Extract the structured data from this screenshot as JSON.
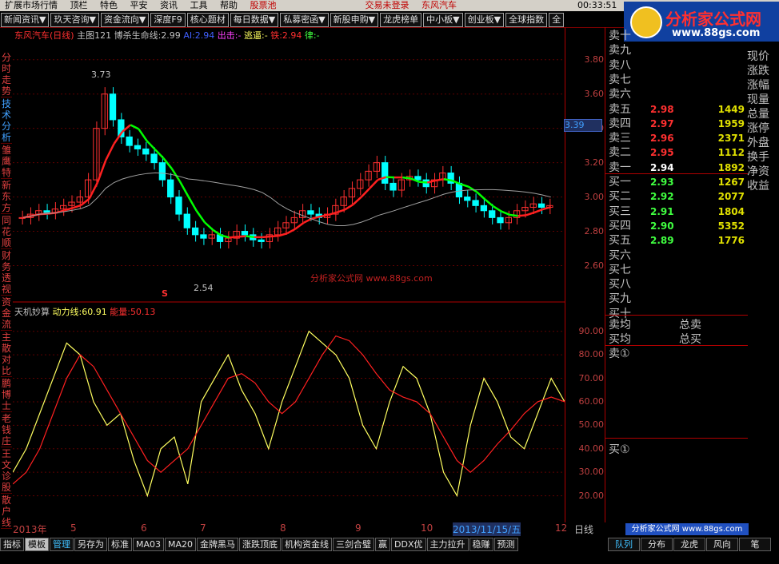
{
  "topbar": {
    "items": [
      "扩展市场行情",
      "顶栏",
      "特色",
      "平安",
      "资讯",
      "工具",
      "帮助"
    ],
    "pool": "股票池",
    "login": "交易未登录",
    "stock": "东风汽车",
    "clock": "00:33:51"
  },
  "menu": [
    "新闻资讯▼",
    "玖天咨询▼",
    "资金流向▼",
    "深度F9",
    "核心题材",
    "每日数据▼",
    "私募密函▼",
    "新股申购▼",
    "龙虎榜单",
    "中小板▼",
    "创业板▼",
    "全球指数",
    "全"
  ],
  "logo": {
    "title": "分析家公式网",
    "url": "www.88gs.com"
  },
  "sidebar": [
    {
      "label": "分时走势",
      "color": "red"
    },
    {
      "label": "技术分析",
      "color": "blue"
    },
    {
      "label": "雏鹰特",
      "color": "red"
    },
    {
      "label": "新东方",
      "color": "red"
    },
    {
      "label": "同花顺",
      "color": "red"
    },
    {
      "label": "财务透视",
      "color": "red"
    },
    {
      "label": "资金流",
      "color": "red"
    },
    {
      "label": "主散对比",
      "color": "red"
    },
    {
      "label": "鹏博士",
      "color": "red"
    },
    {
      "label": "老钱庄",
      "color": "red"
    },
    {
      "label": "王文诊股",
      "color": "red"
    },
    {
      "label": "散户线",
      "color": "red"
    }
  ],
  "main_header": {
    "name": "东风汽车(日线)",
    "chart": "主图121",
    "line1_label": "博杀生命线:",
    "line1_val": "2.99",
    "ai_label": "AI:",
    "ai_val": "2.94",
    "out_label": "出击:",
    "out_val": "-",
    "escape_label": "逃逼:",
    "escape_val": "-",
    "iron_label": "铁:",
    "iron_val": "2.94",
    "law_label": "律:",
    "law_val": "-"
  },
  "sub_header": {
    "name": "天机妙算",
    "power_label": "动力线:",
    "power_val": "60.91",
    "energy_label": "能量:",
    "energy_val": "50.13"
  },
  "annotations": {
    "high": "3.73",
    "low": "2.54",
    "watermark": "分析家公式网 www.88gs.com",
    "s_mark": "S"
  },
  "main_y": [
    "3.80",
    "3.60",
    "3.40",
    "3.20",
    "3.00",
    "2.80",
    "2.60"
  ],
  "sub_y": [
    "90.00",
    "80.00",
    "70.00",
    "60.00",
    "50.00",
    "40.00",
    "30.00",
    "20.00"
  ],
  "price_marker": "3.39",
  "x_axis": [
    "2013年",
    "5",
    "6",
    "7",
    "8",
    "9",
    "10",
    "2013/11/15/五",
    "12"
  ],
  "period": "日线",
  "order_book": {
    "sell": [
      {
        "label": "卖十",
        "price": "",
        "vol": ""
      },
      {
        "label": "卖九",
        "price": "",
        "vol": ""
      },
      {
        "label": "卖八",
        "price": "",
        "vol": ""
      },
      {
        "label": "卖七",
        "price": "",
        "vol": ""
      },
      {
        "label": "卖六",
        "price": "",
        "vol": ""
      },
      {
        "label": "卖五",
        "price": "2.98",
        "vol": "1449"
      },
      {
        "label": "卖四",
        "price": "2.97",
        "vol": "1959"
      },
      {
        "label": "卖三",
        "price": "2.96",
        "vol": "2371"
      },
      {
        "label": "卖二",
        "price": "2.95",
        "vol": "1112"
      },
      {
        "label": "卖一",
        "price": "2.94",
        "vol": "1892"
      }
    ],
    "buy": [
      {
        "label": "买一",
        "price": "2.93",
        "vol": "1267"
      },
      {
        "label": "买二",
        "price": "2.92",
        "vol": "2077"
      },
      {
        "label": "买三",
        "price": "2.91",
        "vol": "1804"
      },
      {
        "label": "买四",
        "price": "2.90",
        "vol": "5352"
      },
      {
        "label": "买五",
        "price": "2.89",
        "vol": "1776"
      },
      {
        "label": "买六",
        "price": "",
        "vol": ""
      },
      {
        "label": "买七",
        "price": "",
        "vol": ""
      },
      {
        "label": "买八",
        "price": "",
        "vol": ""
      },
      {
        "label": "买九",
        "price": "",
        "vol": ""
      },
      {
        "label": "买十",
        "price": "",
        "vol": ""
      }
    ],
    "sell_avg": "卖均",
    "buy_avg": "买均",
    "total_sell": "总卖",
    "total_buy": "总买",
    "sell_queue": "卖①",
    "buy_queue": "买①"
  },
  "right_fields": [
    "现价",
    "涨跌",
    "涨幅",
    "现量",
    "总量",
    "涨停",
    "外盘",
    "",
    "换手",
    "净资",
    "收益"
  ],
  "bottom_tabs": [
    "指标",
    "模板",
    "管理",
    "另存为",
    "标准",
    "MA03",
    "MA20",
    "金牌黑马",
    "涨跌顶底",
    "机构资金线",
    "三剑合璧",
    "赢",
    "DDX优",
    "主力拉升",
    "稳赚",
    "预测"
  ],
  "bottom_right": [
    "队列",
    "分布",
    "龙虎",
    "风向",
    "笔"
  ],
  "bottom_logo": "分析家公式网 www.88gs.com",
  "colors": {
    "up": "#ff3030",
    "down": "#00ffff",
    "green_line": "#00ff00",
    "red_line": "#ff2020",
    "magenta": "#ff00ff",
    "yellow": "#ffff60",
    "grid": "#800000"
  },
  "chart_data": {
    "type": "line",
    "title": "东风汽车(日线)",
    "main_ylim": [
      2.5,
      3.85
    ],
    "sub_ylim": [
      10,
      95
    ],
    "x_labels": [
      "2013年",
      "5",
      "6",
      "7",
      "8",
      "9",
      "10",
      "2013/11/15/五",
      "12"
    ],
    "price_close": [
      2.88,
      2.9,
      2.92,
      2.91,
      2.93,
      2.95,
      2.97,
      3.0,
      3.1,
      3.4,
      3.6,
      3.45,
      3.35,
      3.3,
      3.28,
      3.25,
      3.2,
      3.1,
      3.0,
      2.9,
      2.82,
      2.78,
      2.76,
      2.78,
      2.74,
      2.76,
      2.8,
      2.78,
      2.75,
      2.74,
      2.78,
      2.82,
      2.85,
      2.88,
      2.92,
      2.9,
      2.88,
      2.9,
      2.95,
      3.0,
      3.05,
      3.1,
      3.15,
      3.2,
      3.08,
      3.04,
      3.1,
      3.12,
      3.1,
      3.06,
      3.1,
      3.14,
      3.08,
      3.0,
      2.98,
      2.95,
      2.92,
      2.88,
      2.85,
      2.88,
      2.92,
      2.94,
      2.96,
      2.94,
      2.95
    ],
    "power_line": [
      30,
      40,
      55,
      70,
      85,
      80,
      60,
      50,
      55,
      35,
      20,
      40,
      45,
      25,
      60,
      70,
      80,
      65,
      55,
      40,
      60,
      75,
      90,
      85,
      80,
      70,
      50,
      40,
      60,
      75,
      70,
      55,
      30,
      20,
      50,
      70,
      60,
      45,
      40,
      55,
      70,
      60
    ],
    "energy_line": [
      25,
      30,
      40,
      55,
      70,
      80,
      75,
      65,
      55,
      45,
      35,
      30,
      35,
      40,
      50,
      60,
      70,
      72,
      68,
      60,
      55,
      60,
      70,
      80,
      88,
      86,
      80,
      72,
      65,
      62,
      60,
      55,
      45,
      35,
      30,
      35,
      42,
      48,
      55,
      60,
      62,
      60
    ]
  }
}
